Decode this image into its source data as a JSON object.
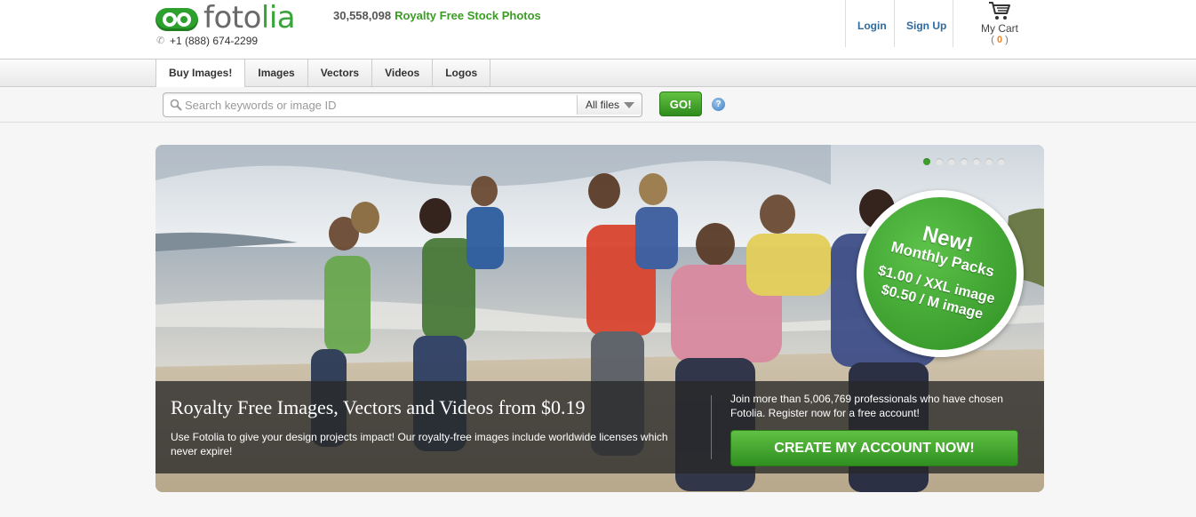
{
  "header": {
    "logo_text_a": "foto",
    "logo_text_b": "lia",
    "phone": "+1 (888) 674-2299",
    "image_count": "30,558,098",
    "tagline": "Royalty Free Stock Photos",
    "login_label": "Login",
    "signup_label": "Sign Up",
    "cart_label": "My Cart",
    "cart_open": "(",
    "cart_count": "0",
    "cart_close": ")"
  },
  "nav": {
    "tabs": [
      "Buy Images!",
      "Images",
      "Vectors",
      "Videos",
      "Logos"
    ]
  },
  "search": {
    "placeholder": "Search keywords or image ID",
    "file_type": "All files",
    "go_label": "GO!",
    "help_label": "?"
  },
  "hero": {
    "promo_new": "New!",
    "promo_monthly": "Monthly Packs",
    "promo_price_xxl": "$1.00 / XXL image",
    "promo_price_m": "$0.50 / M image",
    "title": "Royalty Free Images, Vectors and Videos from $0.19",
    "subtitle": "Use Fotolia to give your design projects impact! Our royalty-free images include worldwide licenses which never expire!",
    "join_text": "Join more than 5,006,769 professionals who have chosen Fotolia. Register now for a free account!",
    "cta_label": "CREATE MY ACCOUNT NOW!",
    "slides": 7,
    "active_slide": 1
  },
  "colors": {
    "brand_green": "#3aa33a",
    "link_blue": "#2d6a9f",
    "cart_orange": "#f58220"
  }
}
